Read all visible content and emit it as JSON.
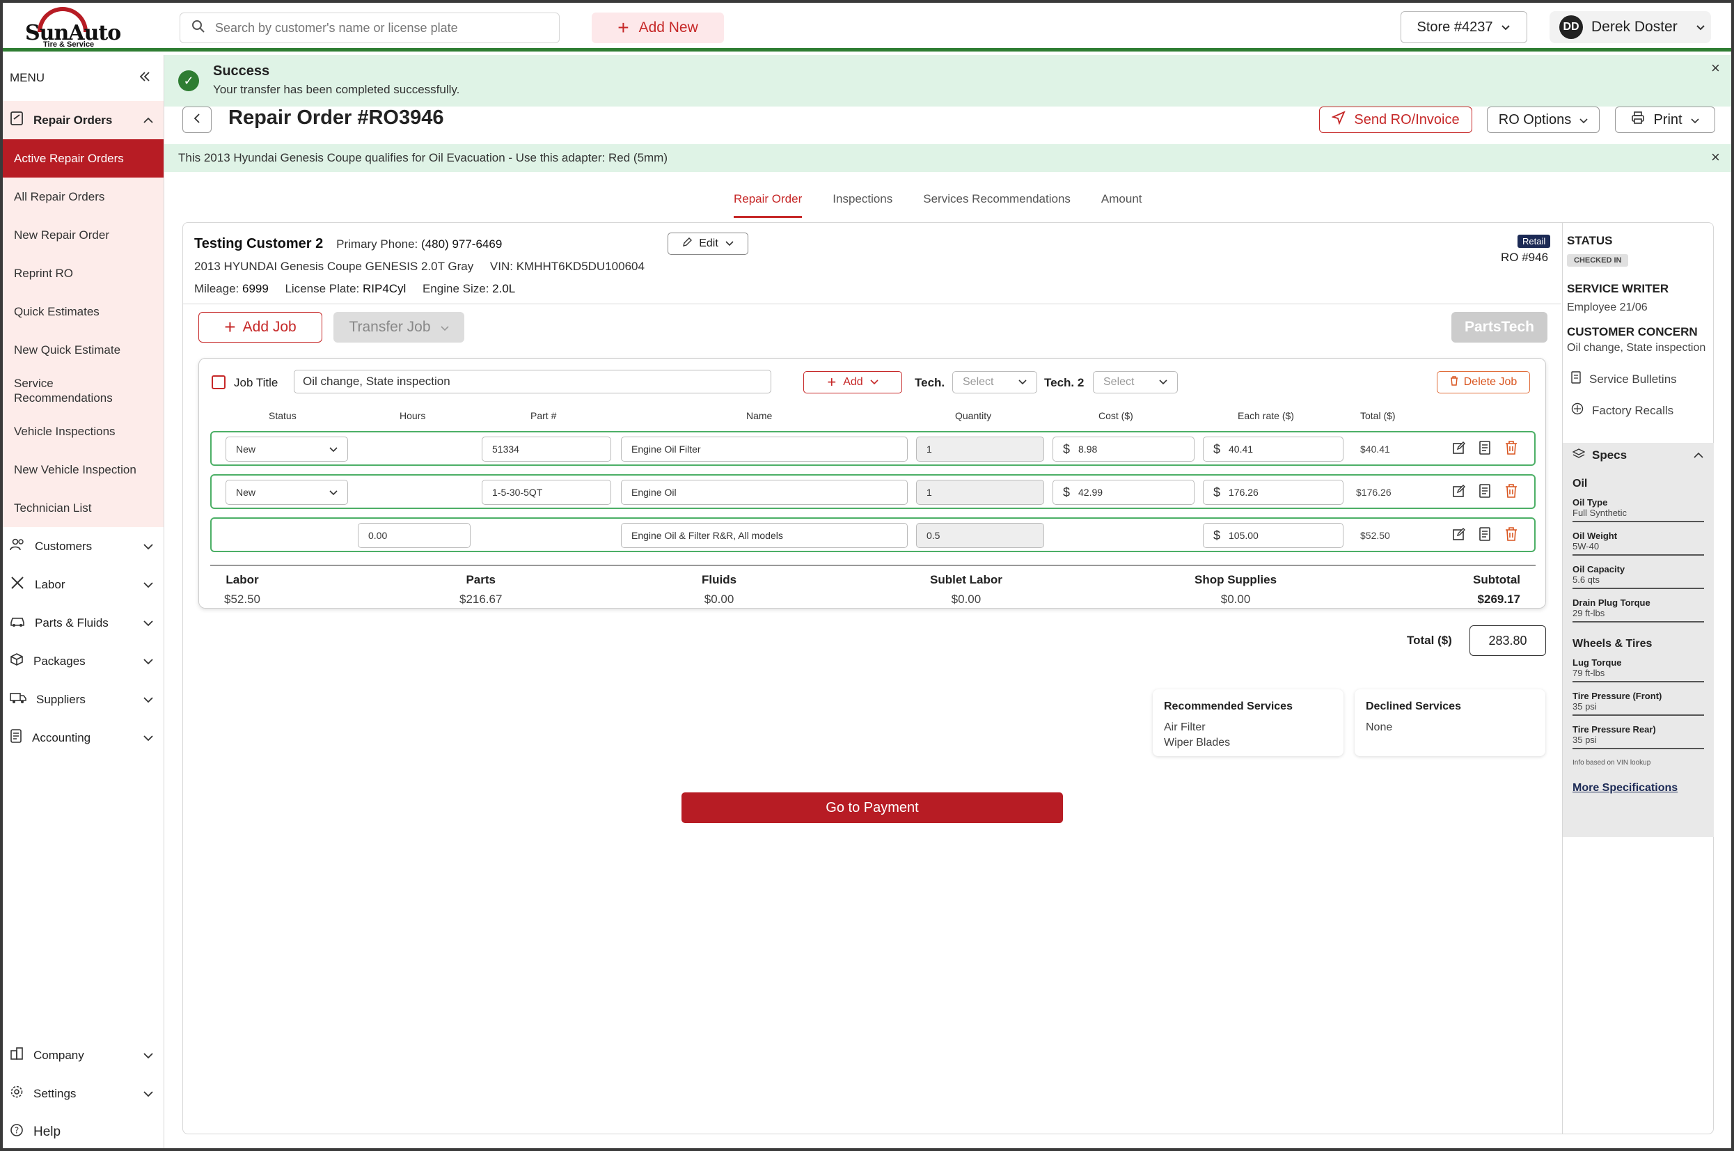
{
  "brand": {
    "name": "SunAuto",
    "tagline": "Tire & Service"
  },
  "topbar": {
    "search_placeholder": "Search by customer's name or license plate",
    "add_new": "Add New",
    "store": "Store #4237",
    "user_initials": "DD",
    "user_name": "Derek Doster"
  },
  "sidebar": {
    "menu_label": "MENU",
    "sections": [
      {
        "label": "Repair Orders",
        "icon": "document-icon",
        "expanded": true
      },
      {
        "label": "Customers",
        "icon": "people-icon"
      },
      {
        "label": "Labor",
        "icon": "tools-icon"
      },
      {
        "label": "Parts & Fluids",
        "icon": "car-icon"
      },
      {
        "label": "Packages",
        "icon": "box-icon"
      },
      {
        "label": "Suppliers",
        "icon": "truck-icon"
      },
      {
        "label": "Accounting",
        "icon": "ledger-icon"
      }
    ],
    "repair_orders_items": [
      "Active Repair Orders",
      "All Repair Orders",
      "New Repair Order",
      "Reprint RO",
      "Quick Estimates",
      "New Quick Estimate",
      "Service Recommendations",
      "Vehicle Inspections",
      "New Vehicle Inspection",
      "Technician List"
    ],
    "bottom": [
      {
        "label": "Company",
        "icon": "building-icon"
      },
      {
        "label": "Settings",
        "icon": "gear-icon"
      },
      {
        "label": "Help",
        "icon": "help-icon"
      }
    ]
  },
  "success": {
    "title": "Success",
    "message": "Your transfer has been completed successfully."
  },
  "header": {
    "title": "Repair Order #RO3946",
    "send": "Send RO/Invoice",
    "options": "RO Options",
    "print": "Print"
  },
  "notice": "This 2013 Hyundai Genesis Coupe qualifies for Oil Evacuation - Use this adapter: Red (5mm)",
  "tabs": [
    "Repair Order",
    "Inspections",
    "Services Recommendations",
    "Amount"
  ],
  "customer": {
    "name": "Testing Customer 2",
    "phone_label": "Primary Phone:",
    "phone": "(480) 977-6469",
    "vehicle": "2013 HYUNDAI Genesis Coupe GENESIS 2.0T Gray",
    "vin_label": "VIN:",
    "vin": "KMHHT6KD5DU100604",
    "mileage_label": "Mileage:",
    "mileage": "6999",
    "plate_label": "License Plate:",
    "plate": "RIP4Cyl",
    "engine_label": "Engine Size:",
    "engine": "2.0L",
    "edit": "Edit",
    "type_badge": "Retail",
    "ro_short": "RO #946"
  },
  "actions": {
    "add_job": "Add Job",
    "transfer_job": "Transfer Job",
    "partstech": "PartsTech"
  },
  "job": {
    "title_label": "Job Title",
    "title_value": "Oil change,  State inspection",
    "add": "Add",
    "tech_label": "Tech.",
    "tech2_label": "Tech. 2",
    "select": "Select",
    "delete": "Delete Job",
    "columns": [
      "Status",
      "Hours",
      "Part #",
      "Name",
      "Quantity",
      "Cost ($)",
      "Each rate ($)",
      "Total ($)"
    ],
    "rows": [
      {
        "status": "New",
        "hours": "",
        "part": "51334",
        "name": "Engine Oil Filter",
        "qty": "1",
        "cost": "8.98",
        "rate": "40.41",
        "total": "$40.41"
      },
      {
        "status": "New",
        "hours": "",
        "part": "1-5-30-5QT",
        "name": "Engine Oil",
        "qty": "1",
        "cost": "42.99",
        "rate": "176.26",
        "total": "$176.26"
      },
      {
        "status": "",
        "hours": "0.00",
        "part": "",
        "name": "Engine Oil & Filter R&R, All models",
        "qty": "0.5",
        "cost": "",
        "rate": "105.00",
        "total": "$52.50"
      }
    ],
    "summary": [
      {
        "label": "Labor",
        "value": "$52.50"
      },
      {
        "label": "Parts",
        "value": "$216.67"
      },
      {
        "label": "Fluids",
        "value": "$0.00"
      },
      {
        "label": "Sublet Labor",
        "value": "$0.00"
      },
      {
        "label": "Shop Supplies",
        "value": "$0.00"
      },
      {
        "label": "Subtotal",
        "value": "$269.17"
      }
    ]
  },
  "total": {
    "label": "Total ($)",
    "value": "283.80"
  },
  "recommended": {
    "title": "Recommended Services",
    "items": [
      "Air Filter",
      "Wiper Blades"
    ]
  },
  "declined": {
    "title": "Declined Services",
    "value": "None"
  },
  "payment": "Go to Payment",
  "right": {
    "status_label": "STATUS",
    "status": "CHECKED IN",
    "writer_label": "SERVICE WRITER",
    "writer": "Employee 21/06",
    "concern_label": "CUSTOMER CONCERN",
    "concern": "Oil change, State inspection",
    "bulletins": "Service Bulletins",
    "recalls": "Factory Recalls",
    "specs_label": "Specs",
    "oil_group": "Oil",
    "oil_specs": [
      {
        "label": "Oil Type",
        "value": "Full Synthetic"
      },
      {
        "label": "Oil Weight",
        "value": "5W-40"
      },
      {
        "label": "Oil Capacity",
        "value": "5.6 qts"
      },
      {
        "label": "Drain Plug Torque",
        "value": "29 ft-lbs"
      }
    ],
    "wheels_group": "Wheels & Tires",
    "wheel_specs": [
      {
        "label": "Lug Torque",
        "value": "79 ft-lbs"
      },
      {
        "label": "Tire Pressure (Front)",
        "value": "35 psi"
      },
      {
        "label": "Tire Pressure Rear)",
        "value": "35 psi"
      }
    ],
    "info": "Info based on VIN lookup",
    "more": "More Specifications"
  }
}
